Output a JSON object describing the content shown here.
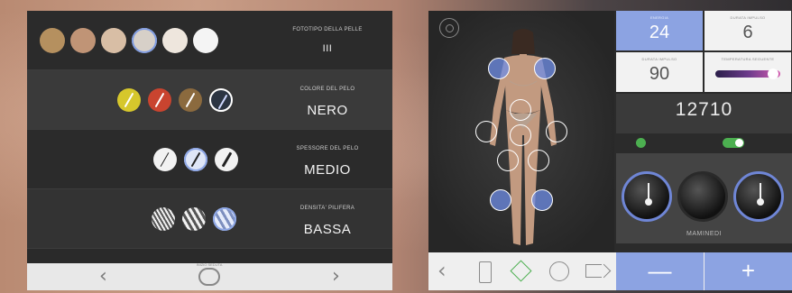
{
  "left_panel": {
    "rows": [
      {
        "title": "FOTOTIPO DELLA PELLE",
        "value": "III"
      },
      {
        "title": "COLORE DEL PELO",
        "value": "NERO"
      },
      {
        "title": "SPESSORE DEL PELO",
        "value": "MEDIO"
      },
      {
        "title": "DENSITA' PILIFERA",
        "value": "BASSA"
      }
    ],
    "skin_swatches": [
      "#b5905f",
      "#c09476",
      "#d8bea5",
      "#d7d0c8",
      "#eee6dd",
      "#f4f4f4"
    ],
    "hair_colors": [
      "#d6c72c",
      "#c9442f",
      "#8b6a3e",
      "#2b3442"
    ],
    "nav": {
      "prev": "‹",
      "next": "›",
      "center_label": "INIZIO SEDUTA"
    }
  },
  "right_panel": {
    "brand_label": "",
    "stats": {
      "energy_label": "ENERGIA",
      "energy_value": "24",
      "freq_label": "DURATA IMPULSO",
      "freq_value": "6",
      "duration_label": "DURATA IMPULSO",
      "duration_value": "90",
      "temp_label": "TEMPERATURA SEGUENTE"
    },
    "total": {
      "label": "",
      "value": "12710"
    },
    "toggles": {
      "left_label": "",
      "right_label": ""
    },
    "dials": {
      "left_label": "",
      "right_label": "",
      "bottom_label": "MAMINEDI"
    },
    "nav": {
      "prev": "‹",
      "minus": "—",
      "plus": "+"
    }
  }
}
